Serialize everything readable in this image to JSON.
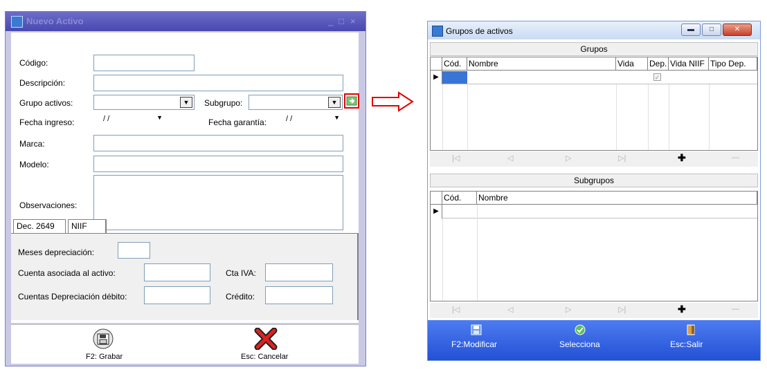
{
  "nuevo_activo": {
    "title": "Nuevo Activo",
    "window_controls": [
      "_",
      "□",
      "×"
    ],
    "labels": {
      "codigo": "Código:",
      "descripcion": "Descripción:",
      "grupo": "Grupo activos:",
      "subgrupo": "Subgrupo:",
      "fecha_ingreso": "Fecha ingreso:",
      "fecha_garantia": "Fecha garantía:",
      "marca": "Marca:",
      "modelo": "Modelo:",
      "observaciones": "Observaciones:"
    },
    "fecha_ingreso_value": "/ /",
    "fecha_garantia_value": "/ /",
    "tabs": [
      "Dec. 2649",
      "NIIF"
    ],
    "tab_fields": {
      "meses": "Meses depreciación:",
      "cuenta_activo": "Cuenta asociada al activo:",
      "cta_iva": "Cta IVA:",
      "cuentas_debito": "Cuentas Depreciación débito:",
      "credito": "Crédito:"
    },
    "buttons": {
      "grabar": "F2: Grabar",
      "cancelar": "Esc: Cancelar"
    }
  },
  "grupos_activos": {
    "title": "Grupos de activos",
    "grupos_section": "Grupos",
    "grupos_columns": [
      "Cód.",
      "Nombre",
      "Vida",
      "Dep.",
      "Vida NIIF",
      "Tipo Dep."
    ],
    "subgrupos_section": "Subgrupos",
    "subgrupos_columns": [
      "Cód.",
      "Nombre"
    ],
    "toolbar": {
      "modificar": "F2:Modificar",
      "selecciona": "Selecciona",
      "salir": "Esc:Salir"
    }
  },
  "colors": {
    "title_blue": "#4848b0",
    "toolbar_blue": "#2351d6",
    "highlight_red": "#e00000"
  }
}
